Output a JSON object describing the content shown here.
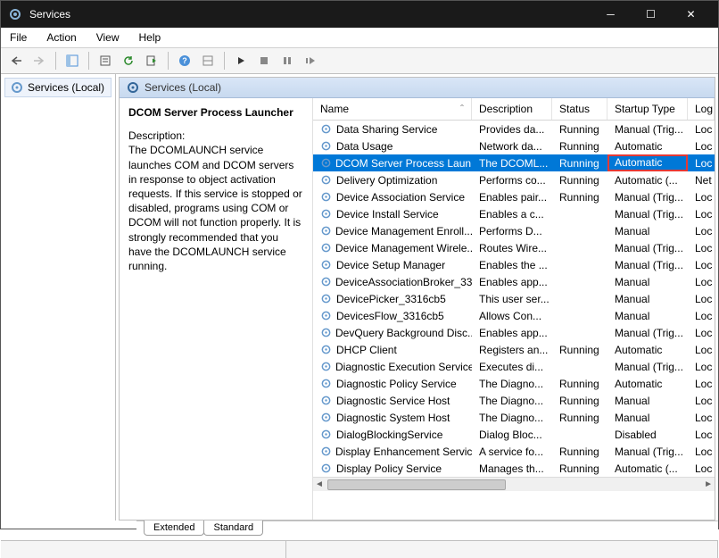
{
  "window": {
    "title": "Services"
  },
  "menu": {
    "file": "File",
    "action": "Action",
    "view": "View",
    "help": "Help"
  },
  "left_pane": {
    "label": "Services (Local)"
  },
  "right_header": {
    "label": "Services (Local)"
  },
  "detail": {
    "title": "DCOM Server Process Launcher",
    "desc_label": "Description:",
    "desc_text": "The DCOMLAUNCH service launches COM and DCOM servers in response to object activation requests. If this service is stopped or disabled, programs using COM or DCOM will not function properly. It is strongly recommended that you have the DCOMLAUNCH service running."
  },
  "columns": {
    "name": "Name",
    "description": "Description",
    "status": "Status",
    "startup": "Startup Type",
    "logon": "Log"
  },
  "services": [
    {
      "name": "Data Sharing Service",
      "desc": "Provides da...",
      "status": "Running",
      "startup": "Manual (Trig...",
      "log": "Loc"
    },
    {
      "name": "Data Usage",
      "desc": "Network da...",
      "status": "Running",
      "startup": "Automatic",
      "log": "Loc"
    },
    {
      "name": "DCOM Server Process Laun...",
      "desc": "The DCOML...",
      "status": "Running",
      "startup": "Automatic",
      "log": "Loc",
      "selected": true,
      "highlight_startup": true
    },
    {
      "name": "Delivery Optimization",
      "desc": "Performs co...",
      "status": "Running",
      "startup": "Automatic (...",
      "log": "Net"
    },
    {
      "name": "Device Association Service",
      "desc": "Enables pair...",
      "status": "Running",
      "startup": "Manual (Trig...",
      "log": "Loc"
    },
    {
      "name": "Device Install Service",
      "desc": "Enables a c...",
      "status": "",
      "startup": "Manual (Trig...",
      "log": "Loc"
    },
    {
      "name": "Device Management Enroll...",
      "desc": "Performs D...",
      "status": "",
      "startup": "Manual",
      "log": "Loc"
    },
    {
      "name": "Device Management Wirele...",
      "desc": "Routes Wire...",
      "status": "",
      "startup": "Manual (Trig...",
      "log": "Loc"
    },
    {
      "name": "Device Setup Manager",
      "desc": "Enables the ...",
      "status": "",
      "startup": "Manual (Trig...",
      "log": "Loc"
    },
    {
      "name": "DeviceAssociationBroker_33...",
      "desc": "Enables app...",
      "status": "",
      "startup": "Manual",
      "log": "Loc"
    },
    {
      "name": "DevicePicker_3316cb5",
      "desc": "This user ser...",
      "status": "",
      "startup": "Manual",
      "log": "Loc"
    },
    {
      "name": "DevicesFlow_3316cb5",
      "desc": "Allows Con...",
      "status": "",
      "startup": "Manual",
      "log": "Loc"
    },
    {
      "name": "DevQuery Background Disc...",
      "desc": "Enables app...",
      "status": "",
      "startup": "Manual (Trig...",
      "log": "Loc"
    },
    {
      "name": "DHCP Client",
      "desc": "Registers an...",
      "status": "Running",
      "startup": "Automatic",
      "log": "Loc"
    },
    {
      "name": "Diagnostic Execution Service",
      "desc": "Executes di...",
      "status": "",
      "startup": "Manual (Trig...",
      "log": "Loc"
    },
    {
      "name": "Diagnostic Policy Service",
      "desc": "The Diagno...",
      "status": "Running",
      "startup": "Automatic",
      "log": "Loc"
    },
    {
      "name": "Diagnostic Service Host",
      "desc": "The Diagno...",
      "status": "Running",
      "startup": "Manual",
      "log": "Loc"
    },
    {
      "name": "Diagnostic System Host",
      "desc": "The Diagno...",
      "status": "Running",
      "startup": "Manual",
      "log": "Loc"
    },
    {
      "name": "DialogBlockingService",
      "desc": "Dialog Bloc...",
      "status": "",
      "startup": "Disabled",
      "log": "Loc"
    },
    {
      "name": "Display Enhancement Service",
      "desc": "A service fo...",
      "status": "Running",
      "startup": "Manual (Trig...",
      "log": "Loc"
    },
    {
      "name": "Display Policy Service",
      "desc": "Manages th...",
      "status": "Running",
      "startup": "Automatic (...",
      "log": "Loc"
    }
  ],
  "tabs": {
    "extended": "Extended",
    "standard": "Standard"
  }
}
